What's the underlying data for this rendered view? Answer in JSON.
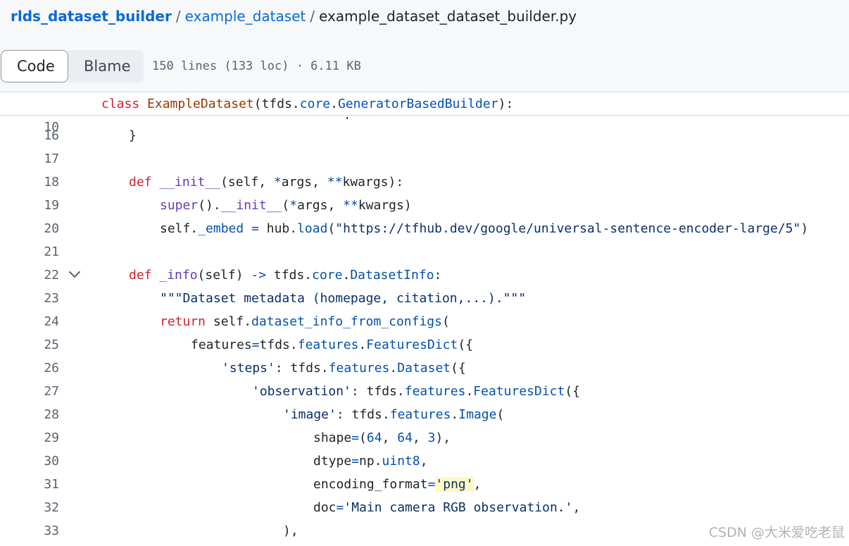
{
  "breadcrumb": {
    "repo": "rlds_dataset_builder",
    "folder": "example_dataset",
    "file": "example_dataset_dataset_builder.py",
    "separator": "/"
  },
  "toolbar": {
    "code_label": "Code",
    "blame_label": "Blame",
    "file_info": "150 lines (133 loc) · 6.11 KB"
  },
  "sticky": {
    "line_number": "10",
    "tokens": [
      {
        "t": "class",
        "c": "k"
      },
      {
        "t": " ",
        "c": "p"
      },
      {
        "t": "ExampleDataset",
        "c": "cls"
      },
      {
        "t": "(tfds.",
        "c": "p"
      },
      {
        "t": "core",
        "c": "a"
      },
      {
        "t": ".",
        "c": "p"
      },
      {
        "t": "GeneratorBasedBuilder",
        "c": "a"
      },
      {
        "t": "):",
        "c": "p"
      }
    ]
  },
  "code_lines": [
    {
      "n": "16",
      "indent": 1,
      "tokens": [
        {
          "t": "}",
          "c": "p"
        }
      ]
    },
    {
      "n": "17",
      "indent": 0,
      "tokens": []
    },
    {
      "n": "18",
      "indent": 1,
      "tokens": [
        {
          "t": "def",
          "c": "k"
        },
        {
          "t": " ",
          "c": "p"
        },
        {
          "t": "__init__",
          "c": "f"
        },
        {
          "t": "(self, ",
          "c": "p"
        },
        {
          "t": "*",
          "c": "a"
        },
        {
          "t": "args, ",
          "c": "p"
        },
        {
          "t": "**",
          "c": "a"
        },
        {
          "t": "kwargs):",
          "c": "p"
        }
      ]
    },
    {
      "n": "19",
      "indent": 2,
      "tokens": [
        {
          "t": "super",
          "c": "f"
        },
        {
          "t": "().",
          "c": "p"
        },
        {
          "t": "__init__",
          "c": "f"
        },
        {
          "t": "(",
          "c": "p"
        },
        {
          "t": "*",
          "c": "a"
        },
        {
          "t": "args, ",
          "c": "p"
        },
        {
          "t": "**",
          "c": "a"
        },
        {
          "t": "kwargs)",
          "c": "p"
        }
      ]
    },
    {
      "n": "20",
      "indent": 2,
      "tokens": [
        {
          "t": "self.",
          "c": "p"
        },
        {
          "t": "_embed",
          "c": "a"
        },
        {
          "t": " ",
          "c": "p"
        },
        {
          "t": "=",
          "c": "a"
        },
        {
          "t": " hub.",
          "c": "p"
        },
        {
          "t": "load",
          "c": "a"
        },
        {
          "t": "(",
          "c": "p"
        },
        {
          "t": "\"https://tfhub.dev/google/universal-sentence-encoder-large/5\"",
          "c": "s"
        },
        {
          "t": ")",
          "c": "p"
        }
      ]
    },
    {
      "n": "21",
      "indent": 0,
      "tokens": []
    },
    {
      "n": "22",
      "indent": 1,
      "fold": true,
      "tokens": [
        {
          "t": "def",
          "c": "k"
        },
        {
          "t": " ",
          "c": "p"
        },
        {
          "t": "_info",
          "c": "f"
        },
        {
          "t": "(self) ",
          "c": "p"
        },
        {
          "t": "->",
          "c": "a"
        },
        {
          "t": " tfds.",
          "c": "p"
        },
        {
          "t": "core",
          "c": "a"
        },
        {
          "t": ".",
          "c": "p"
        },
        {
          "t": "DatasetInfo",
          "c": "a"
        },
        {
          "t": ":",
          "c": "p"
        }
      ]
    },
    {
      "n": "23",
      "indent": 2,
      "tokens": [
        {
          "t": "\"\"\"Dataset metadata (homepage, citation,...).\"\"\"",
          "c": "s"
        }
      ]
    },
    {
      "n": "24",
      "indent": 2,
      "tokens": [
        {
          "t": "return",
          "c": "k"
        },
        {
          "t": " self.",
          "c": "p"
        },
        {
          "t": "dataset_info_from_configs",
          "c": "a"
        },
        {
          "t": "(",
          "c": "p"
        }
      ]
    },
    {
      "n": "25",
      "indent": 3,
      "tokens": [
        {
          "t": "features",
          "c": "p"
        },
        {
          "t": "=",
          "c": "a"
        },
        {
          "t": "tfds.",
          "c": "p"
        },
        {
          "t": "features",
          "c": "a"
        },
        {
          "t": ".",
          "c": "p"
        },
        {
          "t": "FeaturesDict",
          "c": "a"
        },
        {
          "t": "({",
          "c": "p"
        }
      ]
    },
    {
      "n": "26",
      "indent": 4,
      "tokens": [
        {
          "t": "'steps'",
          "c": "s"
        },
        {
          "t": ": tfds.",
          "c": "p"
        },
        {
          "t": "features",
          "c": "a"
        },
        {
          "t": ".",
          "c": "p"
        },
        {
          "t": "Dataset",
          "c": "a"
        },
        {
          "t": "({",
          "c": "p"
        }
      ]
    },
    {
      "n": "27",
      "indent": 5,
      "tokens": [
        {
          "t": "'observation'",
          "c": "s"
        },
        {
          "t": ": tfds.",
          "c": "p"
        },
        {
          "t": "features",
          "c": "a"
        },
        {
          "t": ".",
          "c": "p"
        },
        {
          "t": "FeaturesDict",
          "c": "a"
        },
        {
          "t": "({",
          "c": "p"
        }
      ]
    },
    {
      "n": "28",
      "indent": 6,
      "tokens": [
        {
          "t": "'image'",
          "c": "s"
        },
        {
          "t": ": tfds.",
          "c": "p"
        },
        {
          "t": "features",
          "c": "a"
        },
        {
          "t": ".",
          "c": "p"
        },
        {
          "t": "Image",
          "c": "a"
        },
        {
          "t": "(",
          "c": "p"
        }
      ]
    },
    {
      "n": "29",
      "indent": 7,
      "tokens": [
        {
          "t": "shape",
          "c": "p"
        },
        {
          "t": "=",
          "c": "a"
        },
        {
          "t": "(",
          "c": "p"
        },
        {
          "t": "64",
          "c": "a"
        },
        {
          "t": ", ",
          "c": "p"
        },
        {
          "t": "64",
          "c": "a"
        },
        {
          "t": ", ",
          "c": "p"
        },
        {
          "t": "3",
          "c": "a"
        },
        {
          "t": "),",
          "c": "p"
        }
      ]
    },
    {
      "n": "30",
      "indent": 7,
      "tokens": [
        {
          "t": "dtype",
          "c": "p"
        },
        {
          "t": "=",
          "c": "a"
        },
        {
          "t": "np.",
          "c": "p"
        },
        {
          "t": "uint8",
          "c": "a"
        },
        {
          "t": ",",
          "c": "p"
        }
      ]
    },
    {
      "n": "31",
      "indent": 7,
      "tokens": [
        {
          "t": "encoding_format",
          "c": "p"
        },
        {
          "t": "=",
          "c": "a"
        },
        {
          "t": "'png'",
          "c": "s",
          "hl": true
        },
        {
          "t": ",",
          "c": "p"
        }
      ]
    },
    {
      "n": "32",
      "indent": 7,
      "tokens": [
        {
          "t": "doc",
          "c": "p"
        },
        {
          "t": "=",
          "c": "a"
        },
        {
          "t": "'Main camera RGB observation.'",
          "c": "s"
        },
        {
          "t": ",",
          "c": "p"
        }
      ]
    },
    {
      "n": "33",
      "indent": 6,
      "tokens": [
        {
          "t": "),",
          "c": "p"
        }
      ]
    }
  ],
  "peek_text": ")",
  "watermark": "CSDN @大米爱吃老鼠",
  "colors": {
    "link": "#0969da",
    "keyword": "#cf222e",
    "function": "#6639ba",
    "class_name": "#953800",
    "attribute": "#0550ae",
    "string": "#0a3069",
    "highlight": "#fff8c5",
    "header_bg": "#f6f8fa"
  }
}
